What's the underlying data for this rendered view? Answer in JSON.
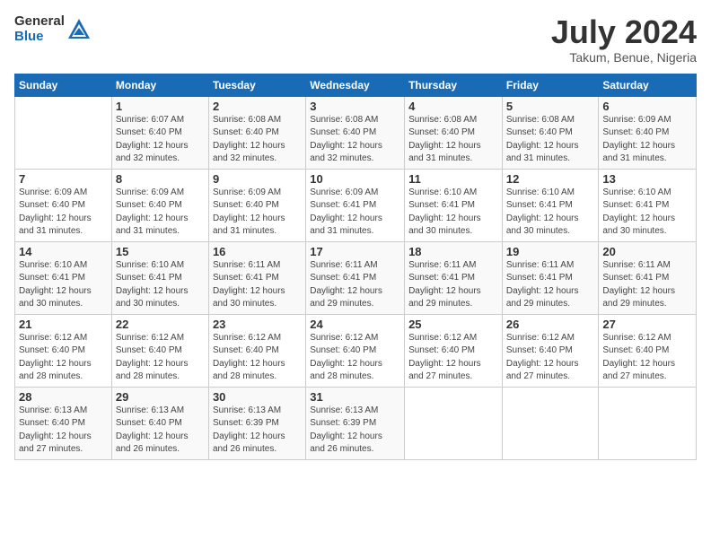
{
  "logo": {
    "general": "General",
    "blue": "Blue"
  },
  "title": "July 2024",
  "location": "Takum, Benue, Nigeria",
  "days_header": [
    "Sunday",
    "Monday",
    "Tuesday",
    "Wednesday",
    "Thursday",
    "Friday",
    "Saturday"
  ],
  "weeks": [
    [
      {
        "day": "",
        "info": ""
      },
      {
        "day": "1",
        "info": "Sunrise: 6:07 AM\nSunset: 6:40 PM\nDaylight: 12 hours\nand 32 minutes."
      },
      {
        "day": "2",
        "info": "Sunrise: 6:08 AM\nSunset: 6:40 PM\nDaylight: 12 hours\nand 32 minutes."
      },
      {
        "day": "3",
        "info": "Sunrise: 6:08 AM\nSunset: 6:40 PM\nDaylight: 12 hours\nand 32 minutes."
      },
      {
        "day": "4",
        "info": "Sunrise: 6:08 AM\nSunset: 6:40 PM\nDaylight: 12 hours\nand 31 minutes."
      },
      {
        "day": "5",
        "info": "Sunrise: 6:08 AM\nSunset: 6:40 PM\nDaylight: 12 hours\nand 31 minutes."
      },
      {
        "day": "6",
        "info": "Sunrise: 6:09 AM\nSunset: 6:40 PM\nDaylight: 12 hours\nand 31 minutes."
      }
    ],
    [
      {
        "day": "7",
        "info": "Sunrise: 6:09 AM\nSunset: 6:40 PM\nDaylight: 12 hours\nand 31 minutes."
      },
      {
        "day": "8",
        "info": "Sunrise: 6:09 AM\nSunset: 6:40 PM\nDaylight: 12 hours\nand 31 minutes."
      },
      {
        "day": "9",
        "info": "Sunrise: 6:09 AM\nSunset: 6:40 PM\nDaylight: 12 hours\nand 31 minutes."
      },
      {
        "day": "10",
        "info": "Sunrise: 6:09 AM\nSunset: 6:41 PM\nDaylight: 12 hours\nand 31 minutes."
      },
      {
        "day": "11",
        "info": "Sunrise: 6:10 AM\nSunset: 6:41 PM\nDaylight: 12 hours\nand 30 minutes."
      },
      {
        "day": "12",
        "info": "Sunrise: 6:10 AM\nSunset: 6:41 PM\nDaylight: 12 hours\nand 30 minutes."
      },
      {
        "day": "13",
        "info": "Sunrise: 6:10 AM\nSunset: 6:41 PM\nDaylight: 12 hours\nand 30 minutes."
      }
    ],
    [
      {
        "day": "14",
        "info": "Sunrise: 6:10 AM\nSunset: 6:41 PM\nDaylight: 12 hours\nand 30 minutes."
      },
      {
        "day": "15",
        "info": "Sunrise: 6:10 AM\nSunset: 6:41 PM\nDaylight: 12 hours\nand 30 minutes."
      },
      {
        "day": "16",
        "info": "Sunrise: 6:11 AM\nSunset: 6:41 PM\nDaylight: 12 hours\nand 30 minutes."
      },
      {
        "day": "17",
        "info": "Sunrise: 6:11 AM\nSunset: 6:41 PM\nDaylight: 12 hours\nand 29 minutes."
      },
      {
        "day": "18",
        "info": "Sunrise: 6:11 AM\nSunset: 6:41 PM\nDaylight: 12 hours\nand 29 minutes."
      },
      {
        "day": "19",
        "info": "Sunrise: 6:11 AM\nSunset: 6:41 PM\nDaylight: 12 hours\nand 29 minutes."
      },
      {
        "day": "20",
        "info": "Sunrise: 6:11 AM\nSunset: 6:41 PM\nDaylight: 12 hours\nand 29 minutes."
      }
    ],
    [
      {
        "day": "21",
        "info": "Sunrise: 6:12 AM\nSunset: 6:40 PM\nDaylight: 12 hours\nand 28 minutes."
      },
      {
        "day": "22",
        "info": "Sunrise: 6:12 AM\nSunset: 6:40 PM\nDaylight: 12 hours\nand 28 minutes."
      },
      {
        "day": "23",
        "info": "Sunrise: 6:12 AM\nSunset: 6:40 PM\nDaylight: 12 hours\nand 28 minutes."
      },
      {
        "day": "24",
        "info": "Sunrise: 6:12 AM\nSunset: 6:40 PM\nDaylight: 12 hours\nand 28 minutes."
      },
      {
        "day": "25",
        "info": "Sunrise: 6:12 AM\nSunset: 6:40 PM\nDaylight: 12 hours\nand 27 minutes."
      },
      {
        "day": "26",
        "info": "Sunrise: 6:12 AM\nSunset: 6:40 PM\nDaylight: 12 hours\nand 27 minutes."
      },
      {
        "day": "27",
        "info": "Sunrise: 6:12 AM\nSunset: 6:40 PM\nDaylight: 12 hours\nand 27 minutes."
      }
    ],
    [
      {
        "day": "28",
        "info": "Sunrise: 6:13 AM\nSunset: 6:40 PM\nDaylight: 12 hours\nand 27 minutes."
      },
      {
        "day": "29",
        "info": "Sunrise: 6:13 AM\nSunset: 6:40 PM\nDaylight: 12 hours\nand 26 minutes."
      },
      {
        "day": "30",
        "info": "Sunrise: 6:13 AM\nSunset: 6:39 PM\nDaylight: 12 hours\nand 26 minutes."
      },
      {
        "day": "31",
        "info": "Sunrise: 6:13 AM\nSunset: 6:39 PM\nDaylight: 12 hours\nand 26 minutes."
      },
      {
        "day": "",
        "info": ""
      },
      {
        "day": "",
        "info": ""
      },
      {
        "day": "",
        "info": ""
      }
    ]
  ]
}
